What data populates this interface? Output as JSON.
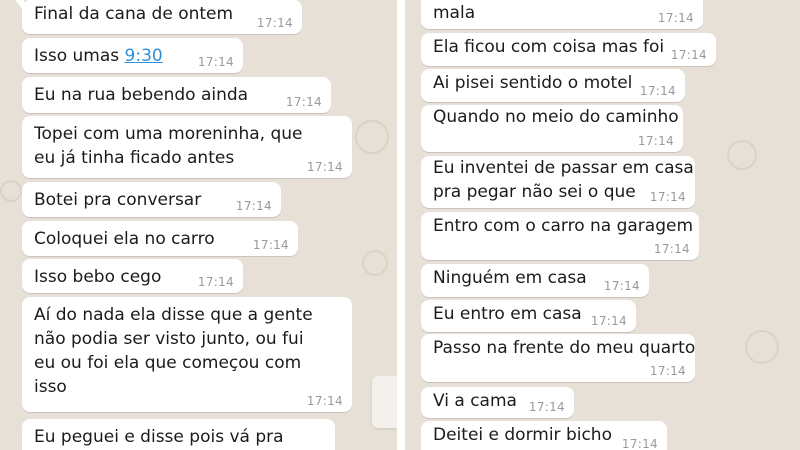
{
  "left_messages": [
    {
      "text": "Final da cana de ontem",
      "time": "17:14"
    },
    {
      "text_before": "Isso umas ",
      "link": "9:30",
      "time": "17:14"
    },
    {
      "text": "Eu na rua bebendo ainda",
      "time": "17:14"
    },
    {
      "text": "Topei com uma moreninha, que\neu já tinha ficado antes",
      "time": "17:14"
    },
    {
      "text": "Botei pra conversar",
      "time": "17:14"
    },
    {
      "text": "Coloquei ela no carro",
      "time": "17:14"
    },
    {
      "text": "Isso bebo cego",
      "time": "17:14"
    },
    {
      "text": "Aí do nada ela disse que a gente\nnão podia ser visto junto, ou fui\neu ou foi ela que começou com\nisso",
      "time": "17:14"
    },
    {
      "text": "Eu peguei e disse pois vá pra",
      "time": ""
    }
  ],
  "right_messages": [
    {
      "text": "mala",
      "time": "17:14"
    },
    {
      "text": "Ela ficou com coisa mas foi",
      "time": "17:14"
    },
    {
      "text": "Ai pisei sentido o motel",
      "time": "17:14"
    },
    {
      "text": "Quando no meio do caminho",
      "time": "17:14"
    },
    {
      "text": "Eu inventei de passar em casa\npra pegar não sei o que",
      "time": "17:14"
    },
    {
      "text": "Entro com o carro na garagem",
      "time": "17:14"
    },
    {
      "text": "Ninguém em casa",
      "time": "17:14"
    },
    {
      "text": "Eu entro em casa",
      "time": "17:14"
    },
    {
      "text": "Passo na frente do meu quarto",
      "time": "17:14"
    },
    {
      "text": "Vi a cama",
      "time": "17:14"
    },
    {
      "text": "Deitei e dormir bicho",
      "time": "17:14"
    }
  ],
  "colors": {
    "chat_background": "#e7e0d6",
    "bubble_background": "#ffffff",
    "timestamp": "#9a9a9a",
    "link": "#2f8fd8"
  }
}
